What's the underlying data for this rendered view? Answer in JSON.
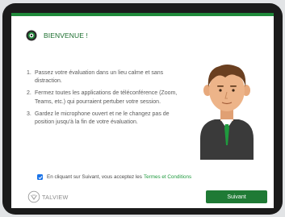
{
  "header": {
    "title": "BIENVENUE !",
    "icon": "webcam-icon"
  },
  "instructions": [
    {
      "number": "1.",
      "text": "Passez votre évaluation dans un lieu calme et sans distraction."
    },
    {
      "number": "2.",
      "text": "Fermez toutes les applications de téléconférence (Zoom, Teams, etc.) qui pourraient pertuber votre session."
    },
    {
      "number": "3.",
      "text": "Gardez le microphone ouvert et ne le changez pas de position jusqu'à la fin de votre évaluation."
    }
  ],
  "illustration": {
    "icon": "person-illustration"
  },
  "consent": {
    "checked": true,
    "text": "En cliquant sur Suivant, vous acceptez les",
    "link_text": "Termes et Conditions"
  },
  "footer": {
    "brand_name": "TALVIEW",
    "brand_icon": "talview-logo-icon",
    "next_label": "Suivant"
  },
  "colors": {
    "accent": "#1f7a35",
    "top_bar": "#1f8a3a",
    "title": "#1b6e2e",
    "link": "#1f9a3e",
    "checkbox": "#1a73e8",
    "device_frame": "#1b1b1b"
  }
}
